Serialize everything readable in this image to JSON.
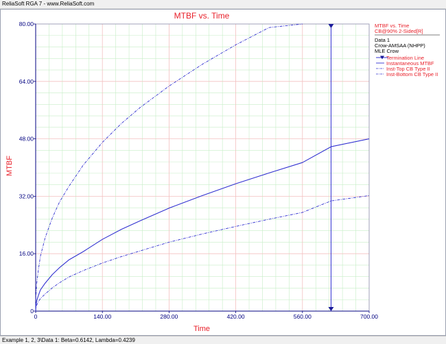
{
  "window": {
    "title": "ReliaSoft RGA 7 - www.ReliaSoft.com",
    "footer_text": "Example 1, 2, 3\\Data 1: Beta=0.6142, Lambda=0.4239"
  },
  "colors": {
    "title_red": "#e8202a",
    "curve_blue": "#3030d0",
    "grid_red": "#f3c0c0",
    "grid_green": "#c6eec6",
    "axis_text": "#000080"
  },
  "chart_data": {
    "type": "line",
    "title": "MTBF vs. Time",
    "xlabel": "Time",
    "ylabel": "MTBF",
    "xlim": [
      0,
      700
    ],
    "ylim": [
      0,
      80
    ],
    "x_ticks": [
      "0",
      "140.00",
      "280.00",
      "420.00",
      "560.00",
      "700.00"
    ],
    "y_ticks": [
      "0",
      "16.00",
      "32.00",
      "48.00",
      "64.00",
      "80.00"
    ],
    "grid": true,
    "legend_position": "right",
    "legend": {
      "header_lines": [
        "MTBF vs. Time",
        "CB@90% 2-Sided[R]"
      ],
      "info_lines": [
        "Data 1",
        "Crow-AMSAA (NHPP)",
        "MLE Crow"
      ],
      "entries": [
        "Termination Line",
        "Instantaneous MTBF",
        "Inst-Top CB Type II",
        "Inst-Bottom CB Type II"
      ]
    },
    "termination_line": {
      "x": 620
    },
    "series": [
      {
        "name": "Instantaneous MTBF",
        "style": "solid",
        "x": [
          0.5,
          2,
          5,
          10,
          20,
          35,
          50,
          70,
          100,
          140,
          180,
          220,
          280,
          350,
          420,
          490,
          560,
          620,
          700
        ],
        "y": [
          1.5,
          2.8,
          4.1,
          5.9,
          7.8,
          10.2,
          12.1,
          14.3,
          16.6,
          20.0,
          22.8,
          25.2,
          28.7,
          32.2,
          35.5,
          38.5,
          41.4,
          45.8,
          48.0
        ]
      },
      {
        "name": "Inst-Top CB Type II",
        "style": "dashdot",
        "x": [
          0.5,
          2,
          5,
          10,
          20,
          35,
          50,
          70,
          100,
          140,
          180,
          220,
          280,
          350,
          420,
          490,
          560
        ],
        "y": [
          4.0,
          7.5,
          10.9,
          15.3,
          20.5,
          26.0,
          30.4,
          34.8,
          40.7,
          47.0,
          52.3,
          56.8,
          62.7,
          68.8,
          74.2,
          79.0,
          80.0
        ]
      },
      {
        "name": "Inst-Bottom CB Type II",
        "style": "dashdot",
        "x": [
          0.5,
          2,
          5,
          10,
          20,
          35,
          50,
          70,
          100,
          140,
          180,
          220,
          280,
          350,
          420,
          490,
          560,
          620,
          700
        ],
        "y": [
          0.8,
          1.6,
          2.5,
          3.5,
          4.8,
          6.5,
          7.9,
          9.5,
          11.3,
          13.4,
          15.2,
          16.8,
          19.2,
          21.5,
          23.6,
          25.6,
          27.5,
          30.7,
          32.2
        ]
      }
    ]
  }
}
